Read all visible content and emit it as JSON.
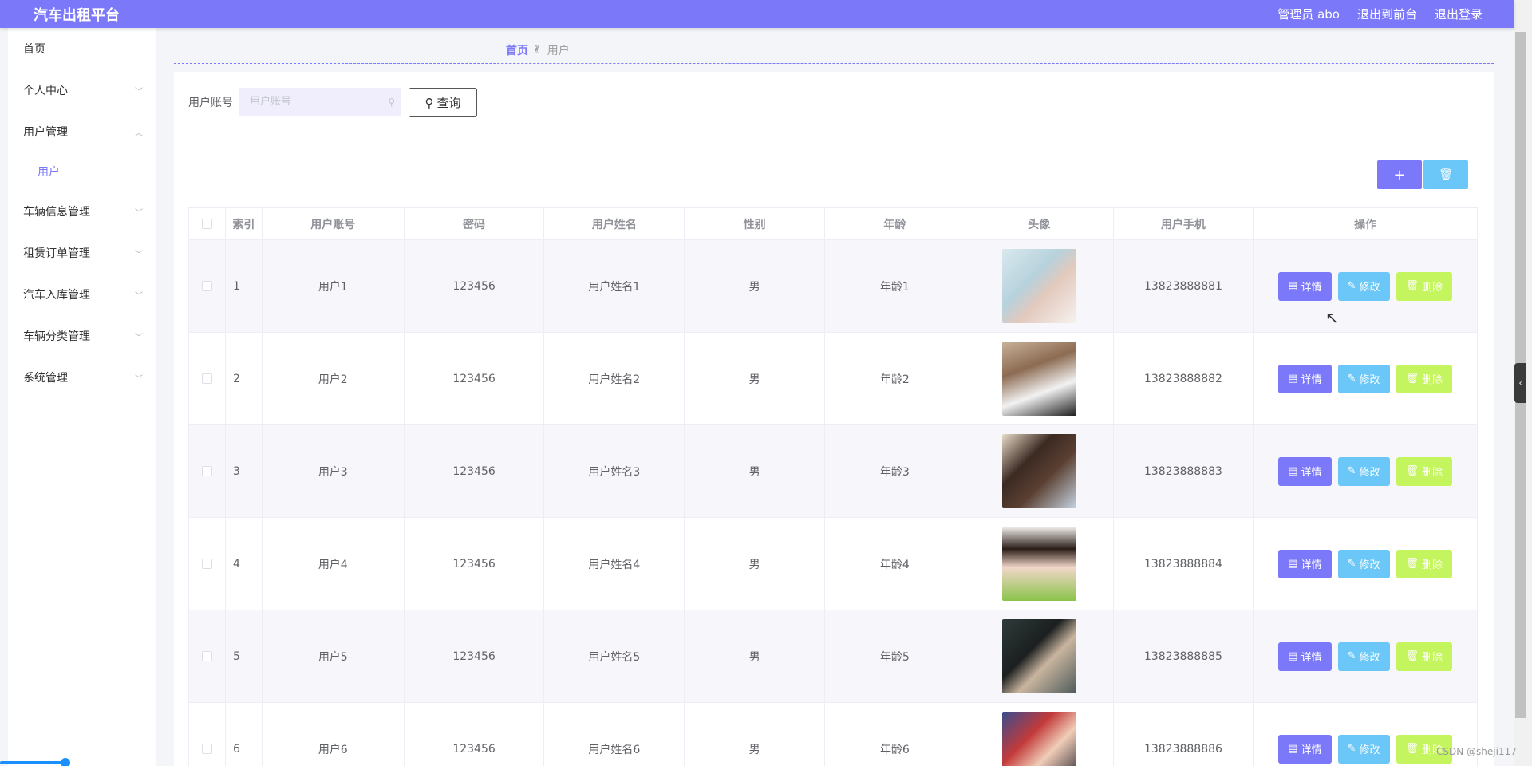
{
  "header": {
    "brand": "汽车出租平台",
    "admin_label": "管理员 abo",
    "back_label": "退出到前台",
    "logout_label": "退出登录"
  },
  "sidebar": {
    "items": [
      {
        "label": "首页",
        "has_chevron": false
      },
      {
        "label": "个人中心",
        "has_chevron": true
      },
      {
        "label": "用户管理",
        "has_chevron": true,
        "expanded": true
      },
      {
        "label": "车辆信息管理",
        "has_chevron": true
      },
      {
        "label": "租赁订单管理",
        "has_chevron": true
      },
      {
        "label": "汽车入库管理",
        "has_chevron": true
      },
      {
        "label": "车辆分类管理",
        "has_chevron": true
      },
      {
        "label": "系统管理",
        "has_chevron": true
      }
    ],
    "sub_item": "用户"
  },
  "breadcrumb": {
    "home": "首页",
    "separator": "✌",
    "current": "用户"
  },
  "search": {
    "label": "用户账号",
    "placeholder": "用户账号",
    "query_label": "查询"
  },
  "toolbar": {
    "add_label": "+",
    "delete_label": "🗑"
  },
  "table": {
    "headers": [
      "索引",
      "用户账号",
      "密码",
      "用户姓名",
      "性别",
      "年龄",
      "头像",
      "用户手机",
      "操作"
    ],
    "rows": [
      {
        "index": "1",
        "account": "用户1",
        "password": "123456",
        "name": "用户姓名1",
        "gender": "男",
        "age": "年龄1",
        "phone": "13823888881"
      },
      {
        "index": "2",
        "account": "用户2",
        "password": "123456",
        "name": "用户姓名2",
        "gender": "男",
        "age": "年龄2",
        "phone": "13823888882"
      },
      {
        "index": "3",
        "account": "用户3",
        "password": "123456",
        "name": "用户姓名3",
        "gender": "男",
        "age": "年龄3",
        "phone": "13823888883"
      },
      {
        "index": "4",
        "account": "用户4",
        "password": "123456",
        "name": "用户姓名4",
        "gender": "男",
        "age": "年龄4",
        "phone": "13823888884"
      },
      {
        "index": "5",
        "account": "用户5",
        "password": "123456",
        "name": "用户姓名5",
        "gender": "男",
        "age": "年龄5",
        "phone": "13823888885"
      },
      {
        "index": "6",
        "account": "用户6",
        "password": "123456",
        "name": "用户姓名6",
        "gender": "男",
        "age": "年龄6",
        "phone": "13823888886"
      }
    ],
    "detail_label": "详情",
    "edit_label": "修改",
    "delete_label": "删除"
  },
  "watermark": "CSDN @sheji117",
  "colors": {
    "primary": "#7b78f9",
    "edit": "#6ac7f7",
    "delete": "#c4f55e"
  }
}
